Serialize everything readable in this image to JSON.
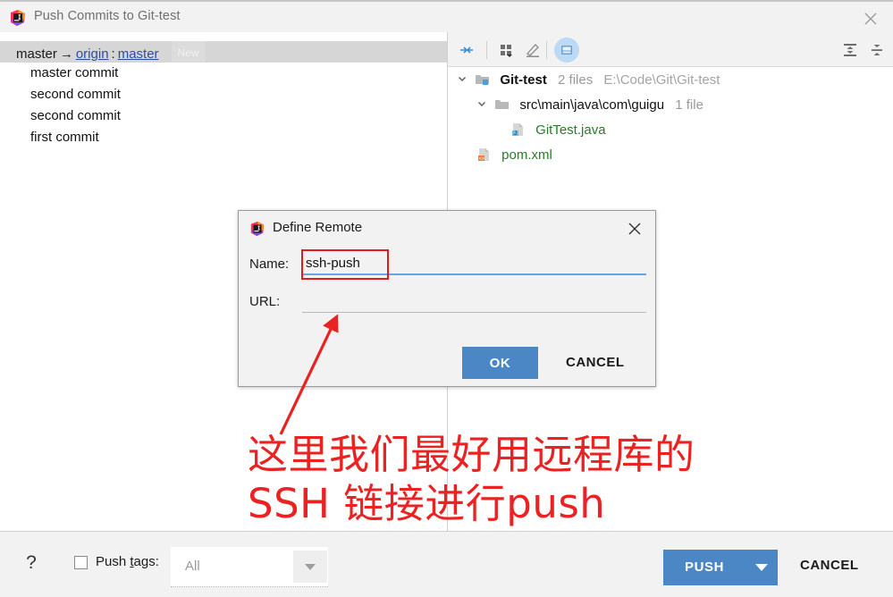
{
  "window": {
    "title": "Push Commits to Git-test",
    "icon": "intellij-idea-icon",
    "close_label": "close-icon"
  },
  "left_pane": {
    "branch_row": {
      "local_branch": "master",
      "arrow": "→",
      "remote_name": "origin",
      "separator": ":",
      "remote_branch": "master",
      "badge": "New"
    },
    "commits": [
      {
        "message": "master commit"
      },
      {
        "message": "second commit"
      },
      {
        "message": "second commit"
      },
      {
        "message": "first commit"
      }
    ]
  },
  "right_pane": {
    "toolbar": {
      "buttons": [
        {
          "name": "collapse-selection-icon",
          "title": "Collapse"
        },
        {
          "name": "group-by-icon",
          "title": "Group By"
        },
        {
          "name": "edit-source-icon",
          "title": "Edit Source"
        },
        {
          "name": "preview-diff-icon",
          "title": "Preview Diff",
          "selected": true
        }
      ],
      "right_buttons": [
        {
          "name": "expand-all-icon",
          "title": "Expand All"
        },
        {
          "name": "collapse-all-icon",
          "title": "Collapse All"
        }
      ]
    },
    "tree": [
      {
        "level": 0,
        "expanded": true,
        "icon": "module-folder-icon",
        "label": "Git-test",
        "count": "2 files",
        "path": "E:\\Code\\Git\\Git-test",
        "color": "dark"
      },
      {
        "level": 1,
        "expanded": true,
        "icon": "folder-icon",
        "label": "src\\main\\java\\com\\guigu",
        "count": "1 file",
        "path": "",
        "color": "dark"
      },
      {
        "level": 2,
        "expanded": null,
        "icon": "java-file-icon",
        "label": "GitTest.java",
        "count": "",
        "path": "",
        "color": "green"
      },
      {
        "level": 1,
        "expanded": null,
        "icon": "xml-file-icon",
        "label": "pom.xml",
        "count": "",
        "path": "",
        "color": "green"
      }
    ]
  },
  "dialog": {
    "icon": "intellij-idea-icon",
    "title": "Define Remote",
    "close_label": "close-icon",
    "name_label": "Name:",
    "name_value": "ssh-push",
    "name_placeholder": "",
    "url_label": "URL:",
    "url_value": "",
    "url_placeholder": "",
    "ok_label": "OK",
    "cancel_label": "CANCEL"
  },
  "bottom_bar": {
    "help_label": "?",
    "push_tags_label_before": "Push ",
    "push_tags_label_mnemonic": "t",
    "push_tags_label_after": "ags:",
    "push_tags_checked": false,
    "tags_combo_value": "All",
    "push_label": "PUSH",
    "cancel_label": "CANCEL"
  },
  "annotation": {
    "line1": "这里我们最好用远程库的",
    "line2": "SSH 链接进行push",
    "color": "#ea2222",
    "arrow": "red-arrow-annotation"
  },
  "colors": {
    "accent_blue": "#4a87c4",
    "link_blue": "#2a4fa2",
    "field_underline": "#6aa3dd",
    "annotation_red": "#ea2222",
    "file_green": "#2a7a2a",
    "panel_bg": "#f2f2f2"
  }
}
